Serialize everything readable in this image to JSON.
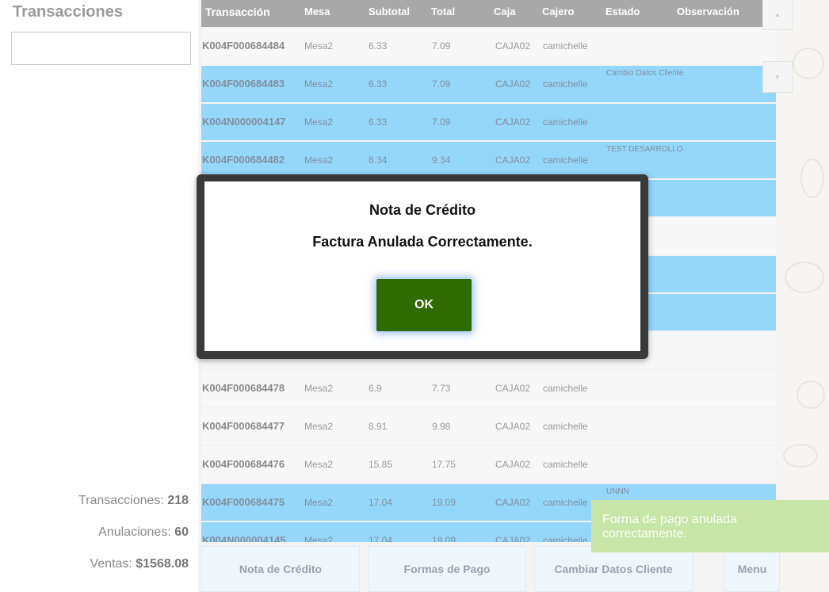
{
  "sidebar": {
    "title": "Transacciones",
    "search_value": "",
    "stats": [
      {
        "label": "Transacciones: ",
        "value": "218"
      },
      {
        "label": "Anulaciones: ",
        "value": "60"
      },
      {
        "label": "Ventas: ",
        "value": "$1568.08"
      }
    ]
  },
  "table": {
    "headers": {
      "transaccion": "Transacción",
      "mesa": "Mesa",
      "subtotal": "Subtotal",
      "total": "Total",
      "caja": "Caja",
      "cajero": "Cajero",
      "estado": "Estado",
      "observacion": "Observación"
    },
    "rows": [
      {
        "tx": "K004F000684484",
        "mesa": "Mesa2",
        "sub": "6.33",
        "tot": "7.09",
        "caja": "CAJA02",
        "cajero": "camichelle",
        "obs": "",
        "selected": false
      },
      {
        "tx": "K004F000684483",
        "mesa": "Mesa2",
        "sub": "6.33",
        "tot": "7.09",
        "caja": "CAJA02",
        "cajero": "camichelle",
        "obs": "Cambio Datos Cliente",
        "selected": true
      },
      {
        "tx": "K004N000004147",
        "mesa": "Mesa2",
        "sub": "6.33",
        "tot": "7.09",
        "caja": "CAJA02",
        "cajero": "camichelle",
        "obs": "",
        "selected": true
      },
      {
        "tx": "K004F000684482",
        "mesa": "Mesa2",
        "sub": "8.34",
        "tot": "9.34",
        "caja": "CAJA02",
        "cajero": "camichelle",
        "obs": "TEST DESARROLLO",
        "selected": true
      },
      {
        "tx": "",
        "mesa": "",
        "sub": "",
        "tot": "",
        "caja": "",
        "cajero": "",
        "obs": "",
        "selected": true
      },
      {
        "tx": "",
        "mesa": "",
        "sub": "",
        "tot": "",
        "caja": "",
        "cajero": "",
        "obs": "",
        "selected": false
      },
      {
        "tx": "",
        "mesa": "",
        "sub": "",
        "tot": "",
        "caja": "",
        "cajero": "",
        "obs": "",
        "selected": true
      },
      {
        "tx": "",
        "mesa": "",
        "sub": "",
        "tot": "",
        "caja": "",
        "cajero": "",
        "obs": "",
        "selected": true
      },
      {
        "tx": "",
        "mesa": "",
        "sub": "",
        "tot": "",
        "caja": "",
        "cajero": "",
        "obs": "",
        "selected": false
      },
      {
        "tx": "K004F000684478",
        "mesa": "Mesa2",
        "sub": "6.9",
        "tot": "7.73",
        "caja": "CAJA02",
        "cajero": "camichelle",
        "obs": "",
        "selected": false
      },
      {
        "tx": "K004F000684477",
        "mesa": "Mesa2",
        "sub": "8.91",
        "tot": "9.98",
        "caja": "CAJA02",
        "cajero": "camichelle",
        "obs": "",
        "selected": false
      },
      {
        "tx": "K004F000684476",
        "mesa": "Mesa2",
        "sub": "15.85",
        "tot": "17.75",
        "caja": "CAJA02",
        "cajero": "camichelle",
        "obs": "",
        "selected": false
      },
      {
        "tx": "K004F000684475",
        "mesa": "Mesa2",
        "sub": "17.04",
        "tot": "19.09",
        "caja": "CAJA02",
        "cajero": "camichelle",
        "obs": "UNNN",
        "selected": true
      },
      {
        "tx": "K004N000004145",
        "mesa": "Mesa2",
        "sub": "17.04",
        "tot": "19.09",
        "caja": "CAJA02",
        "cajero": "camichelle",
        "obs": "",
        "selected": true
      }
    ]
  },
  "scroll": {
    "up_icon": "▲",
    "down_icon": "▼"
  },
  "bottom_buttons": {
    "nota_credito": "Nota de Crédito",
    "formas_pago": "Formas de Pago",
    "cambiar_datos": "Cambiar Datos Cliente",
    "menu": "Menu"
  },
  "modal": {
    "title": "Nota de Crédito",
    "message": "Factura Anulada Correctamente.",
    "ok_label": "OK",
    "ok_color": "#2f6b00"
  },
  "toast": {
    "message": "Forma de pago anulada correctamente."
  }
}
